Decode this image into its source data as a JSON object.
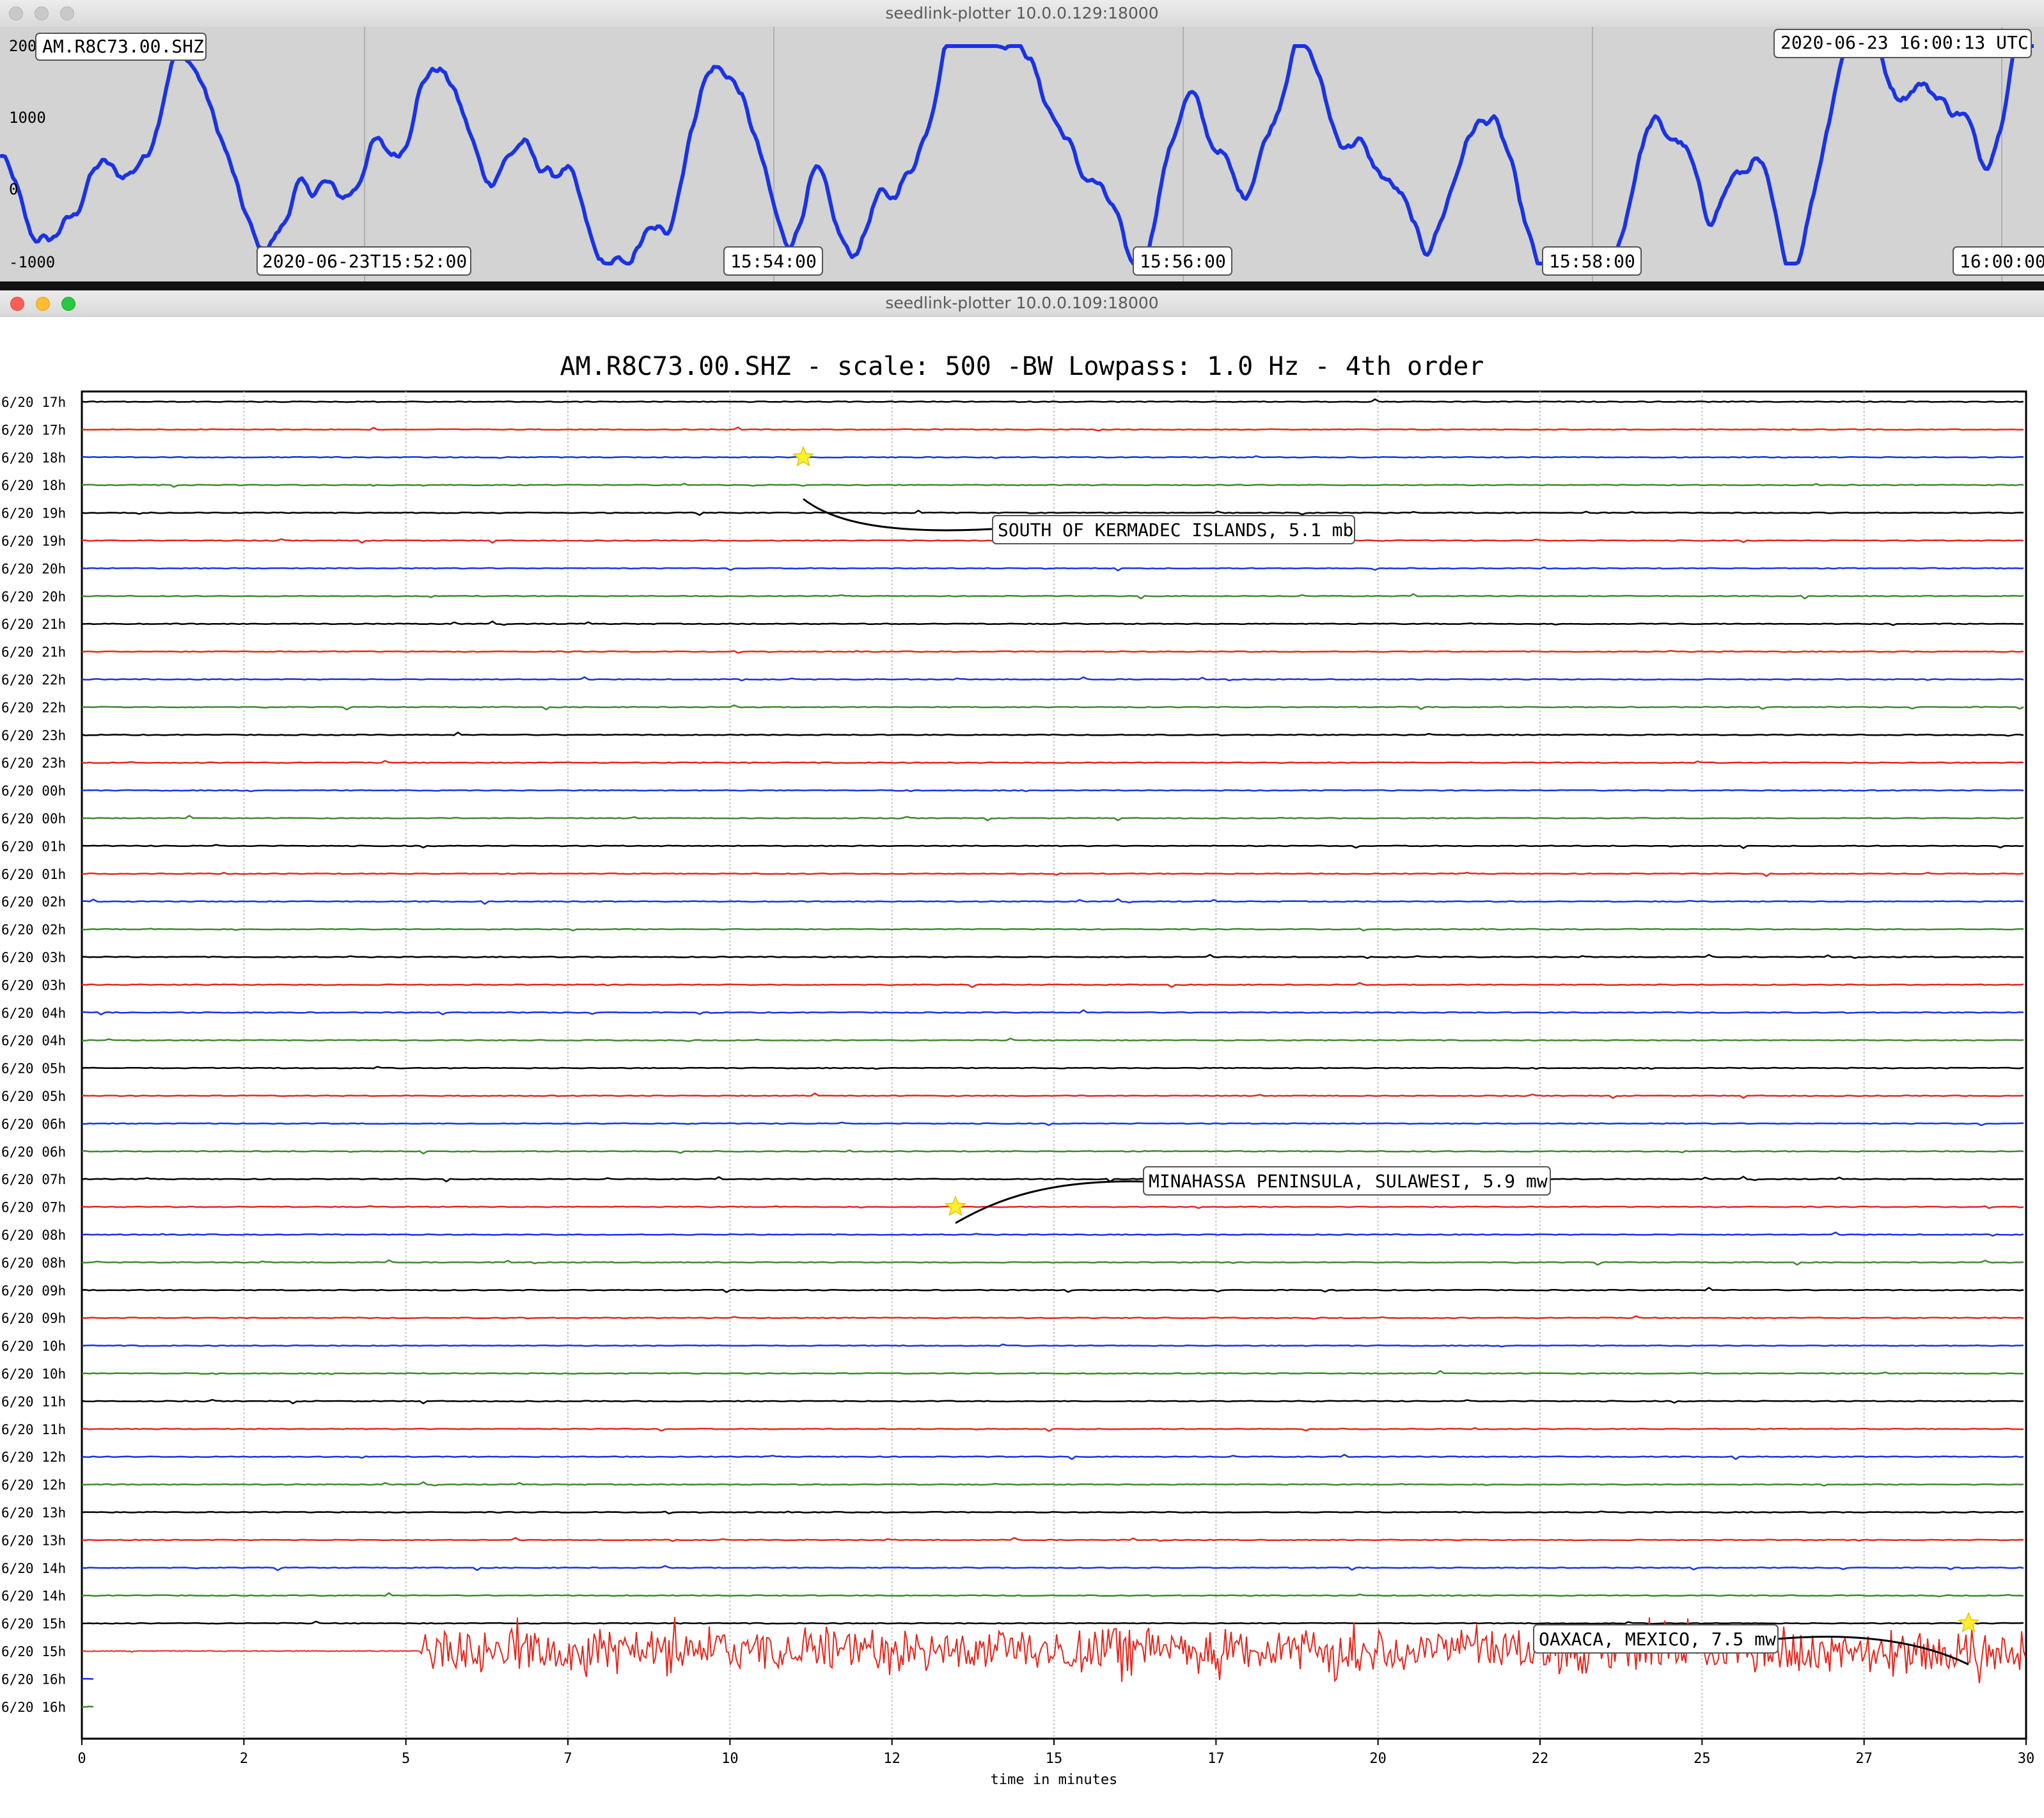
{
  "top_window": {
    "title": "seedlink-plotter 10.0.0.129:18000",
    "channel_label": "AM.R8C73.00.SHZ",
    "utc_label": "2020-06-23 16:00:13 UTC",
    "y_ticks": [
      "200",
      "1000",
      "0",
      "-1000"
    ],
    "x_ticks": [
      "2020-06-23T15:52:00",
      "15:54:00",
      "15:56:00",
      "15:58:00",
      "16:00:00"
    ],
    "trace_color": "#1a33e6"
  },
  "main_window": {
    "title": "seedlink-plotter 10.0.0.109:18000",
    "plot_title": "AM.R8C73.00.SHZ - scale: 500 -BW Lowpass: 1.0 Hz - 4th order",
    "row_labels": [
      "6/20 17h",
      "6/20 17h",
      "6/20 18h",
      "6/20 18h",
      "6/20 19h",
      "6/20 19h",
      "6/20 20h",
      "6/20 20h",
      "6/20 21h",
      "6/20 21h",
      "6/20 22h",
      "6/20 22h",
      "6/20 23h",
      "6/20 23h",
      "6/20 00h",
      "6/20 00h",
      "6/20 01h",
      "6/20 01h",
      "6/20 02h",
      "6/20 02h",
      "6/20 03h",
      "6/20 03h",
      "6/20 04h",
      "6/20 04h",
      "6/20 05h",
      "6/20 05h",
      "6/20 06h",
      "6/20 06h",
      "6/20 07h",
      "6/20 07h",
      "6/20 08h",
      "6/20 08h",
      "6/20 09h",
      "6/20 09h",
      "6/20 10h",
      "6/20 10h",
      "6/20 11h",
      "6/20 11h",
      "6/20 12h",
      "6/20 12h",
      "6/20 13h",
      "6/20 13h",
      "6/20 14h",
      "6/20 14h",
      "6/20 15h",
      "6/20 15h",
      "6/20 16h",
      "6/20 16h"
    ],
    "x_ticks": [
      "0",
      "2",
      "5",
      "7",
      "10",
      "12",
      "15",
      "17",
      "20",
      "22",
      "25",
      "27",
      "30"
    ],
    "xlabel": "time in minutes",
    "line_colors": [
      "#000000",
      "#e3281e",
      "#1a33e6",
      "#3f8a2f"
    ],
    "events": [
      {
        "label": "SOUTH OF KERMADEC ISLANDS, 5.1 mb",
        "marker": "star-icon"
      },
      {
        "label": "MINAHASSA PENINSULA, SULAWESI, 5.9 mw",
        "marker": "star-icon"
      },
      {
        "label": "OAXACA, MEXICO, 7.5 mw",
        "marker": "star-icon"
      }
    ]
  }
}
